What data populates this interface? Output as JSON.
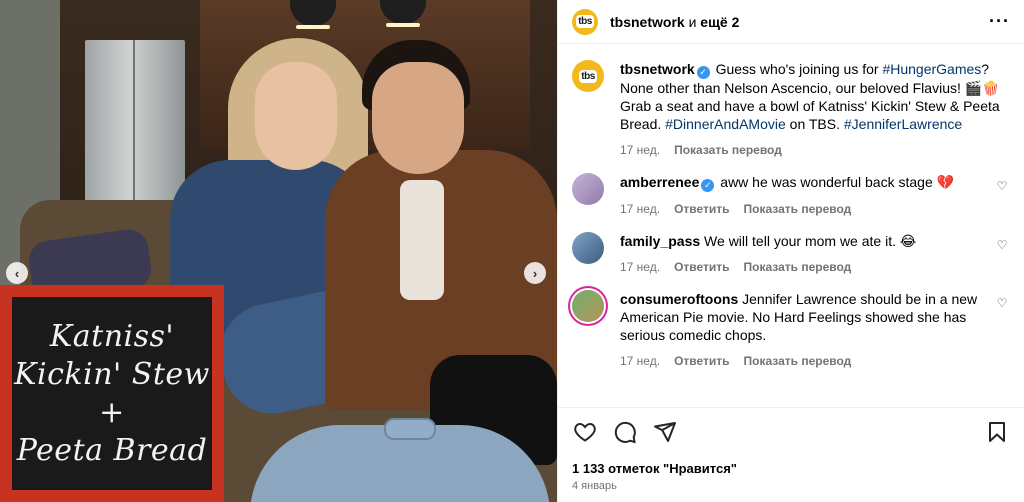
{
  "header": {
    "username": "tbsnetwork",
    "conjunction": " и ",
    "more_label": "ещё 2",
    "avatar_text": "tbs",
    "menu_icon": "more-horizontal-icon"
  },
  "caption": {
    "username": "tbsnetwork",
    "text_1": " Guess who's joining us for ",
    "tag_1": "#HungerGames",
    "text_2": "? None other than Nelson Ascencio, our beloved Flavius! 🎬🍿 Grab a seat and have a bowl of Katniss' Kickin' Stew & Peeta Bread. ",
    "tag_2": "#DinnerAndAMovie",
    "text_3": " on TBS. ",
    "tag_3": "#JenniferLawrence",
    "time": "17 нед.",
    "translate": "Показать перевод"
  },
  "comments": [
    {
      "username": "amberrenee",
      "verified": true,
      "text": " aww he was wonderful back stage 💔",
      "time": "17 нед.",
      "reply": "Ответить",
      "translate": "Показать перевод"
    },
    {
      "username": "family_pass",
      "text": " We will tell your mom we ate it. 😂",
      "time": "17 нед.",
      "reply": "Ответить",
      "translate": "Показать перевод"
    },
    {
      "username": "consumeroftoons",
      "text": " Jennifer Lawrence should be in a new American Pie movie. No Hard Feelings showed she has serious comedic chops.",
      "time": "17 нед.",
      "reply": "Ответить",
      "translate": "Показать перевод"
    }
  ],
  "likes": "1 133 отметок \"Нравится\"",
  "date": "4 январь",
  "board": {
    "line_1": "Katniss'",
    "line_2": "Kickin' Stew",
    "line_3": "+",
    "line_4": "Peeta Bread"
  },
  "icons": {
    "like": "heart-icon",
    "comment": "comment-icon",
    "share": "share-icon",
    "save": "bookmark-icon",
    "prev": "chevron-left-icon",
    "next": "chevron-right-icon"
  },
  "colors": {
    "link": "#00376b",
    "verified": "#3797f0",
    "brand_avatar": "#f2b91c",
    "muted": "#737373"
  }
}
